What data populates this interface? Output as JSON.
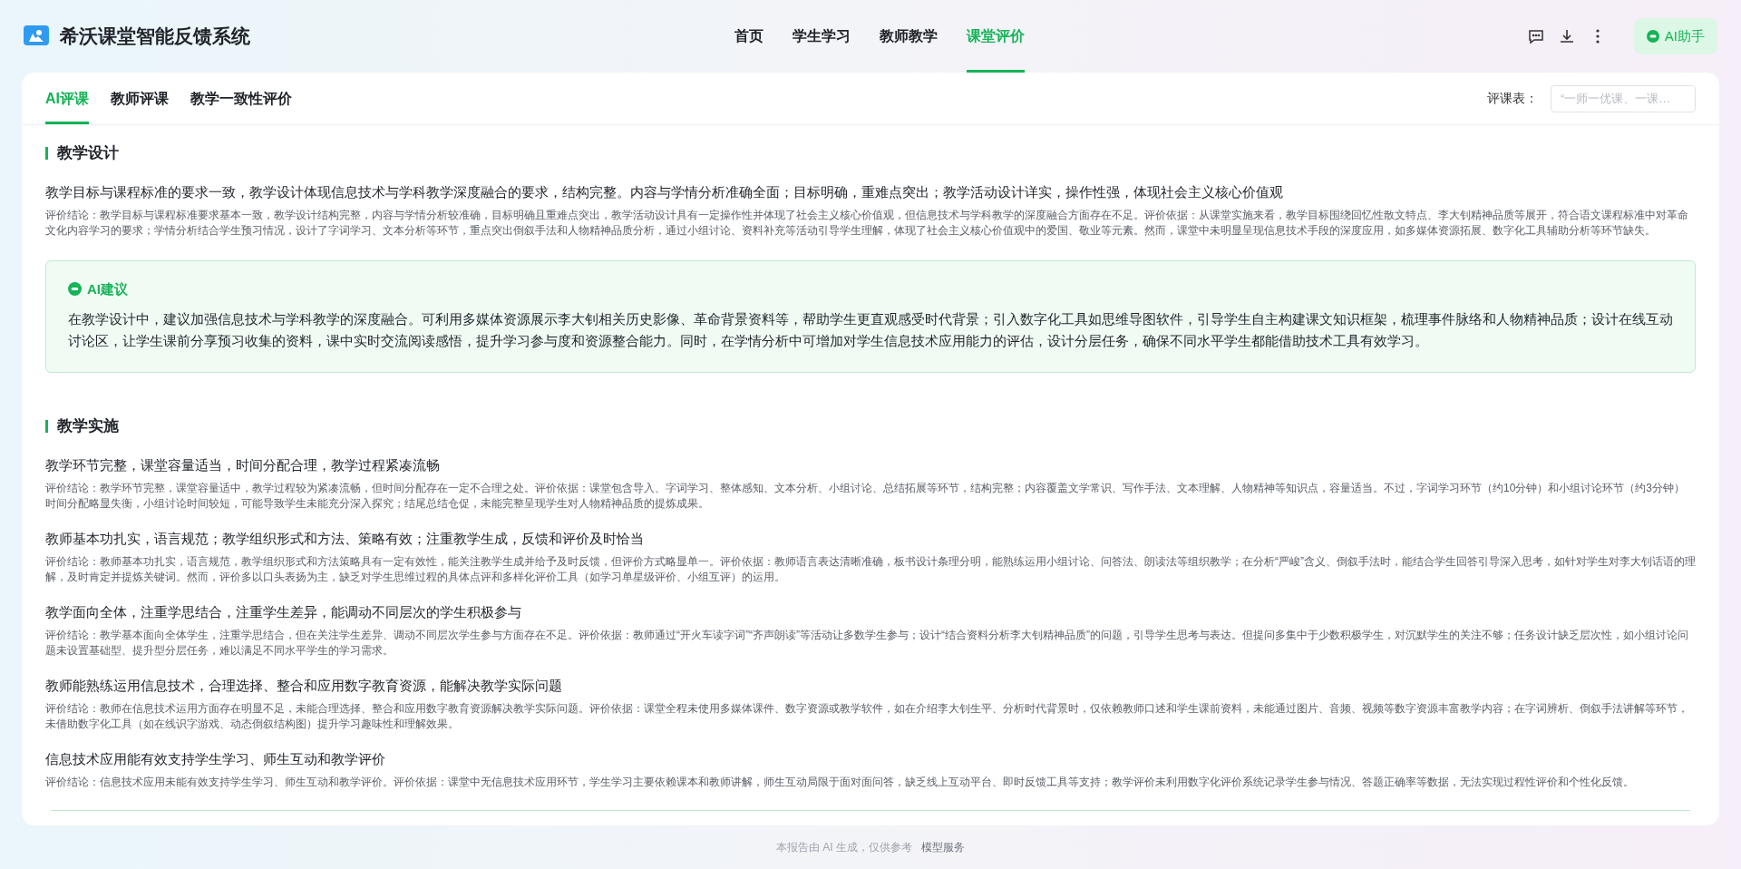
{
  "app": {
    "title": "希沃课堂智能反馈系统"
  },
  "nav": [
    {
      "label": "首页",
      "selected": false
    },
    {
      "label": "学生学习",
      "selected": false
    },
    {
      "label": "教师教学",
      "selected": false
    },
    {
      "label": "课堂评价",
      "selected": true
    }
  ],
  "assistant_button": {
    "label": "AI助手"
  },
  "tabs": [
    {
      "label": "AI评课",
      "selected": true
    },
    {
      "label": "教师评课",
      "selected": false
    },
    {
      "label": "教学一致性评价",
      "selected": false
    }
  ],
  "rubric": {
    "label": "评课表：",
    "placeholder": "“一师一优课、一课…"
  },
  "sections": [
    {
      "title": "教学设计",
      "items": [
        {
          "kind": "criterion",
          "title": "教学目标与课程标准的要求一致，教学设计体现信息技术与学科教学深度融合的要求，结构完整。内容与学情分析准确全面；目标明确，重难点突出；教学活动设计详实，操作性强，体现社会主义核心价值观",
          "text": "评价结论：教学目标与课程标准要求基本一致，教学设计结构完整，内容与学情分析较准确，目标明确且重难点突出，教学活动设计具有一定操作性并体现了社会主义核心价值观，但信息技术与学科教学的深度融合方面存在不足。评价依据：从课堂实施来看，教学目标围绕回忆性散文特点、李大钊精神品质等展开，符合语文课程标准中对革命文化内容学习的要求；学情分析结合学生预习情况，设计了字词学习、文本分析等环节，重点突出倒叙手法和人物精神品质分析，通过小组讨论、资料补充等活动引导学生理解，体现了社会主义核心价值观中的爱国、敬业等元素。然而，课堂中未明显呈现信息技术手段的深度应用，如多媒体资源拓展、数字化工具辅助分析等环节缺失。"
        },
        {
          "kind": "suggestion",
          "title": "AI建议",
          "text": "在教学设计中，建议加强信息技术与学科教学的深度融合。可利用多媒体资源展示李大钊相关历史影像、革命背景资料等，帮助学生更直观感受时代背景；引入数字化工具如思维导图软件，引导学生自主构建课文知识框架，梳理事件脉络和人物精神品质；设计在线互动讨论区，让学生课前分享预习收集的资料，课中实时交流阅读感悟，提升学习参与度和资源整合能力。同时，在学情分析中可增加对学生信息技术应用能力的评估，设计分层任务，确保不同水平学生都能借助技术工具有效学习。"
        }
      ]
    },
    {
      "title": "教学实施",
      "items": [
        {
          "kind": "criterion",
          "title": "教学环节完整，课堂容量适当，时间分配合理，教学过程紧凑流畅",
          "text": "评价结论：教学环节完整，课堂容量适中，教学过程较为紧凑流畅，但时间分配存在一定不合理之处。评价依据：课堂包含导入、字词学习、整体感知、文本分析、小组讨论、总结拓展等环节，结构完整；内容覆盖文学常识、写作手法、文本理解、人物精神等知识点，容量适当。不过，字词学习环节（约10分钟）和小组讨论环节（约3分钟）时间分配略显失衡，小组讨论时间较短，可能导致学生未能充分深入探究；结尾总结仓促，未能完整呈现学生对人物精神品质的提炼成果。"
        },
        {
          "kind": "criterion",
          "title": "教师基本功扎实，语言规范；教学组织形式和方法、策略有效；注重教学生成，反馈和评价及时恰当",
          "text": "评价结论：教师基本功扎实，语言规范，教学组织形式和方法策略具有一定有效性，能关注教学生成并给予及时反馈，但评价方式略显单一。评价依据：教师语言表达清晰准确，板书设计条理分明，能熟练运用小组讨论、问答法、朗读法等组织教学；在分析“严峻”含义、倒叙手法时，能结合学生回答引导深入思考，如针对学生对李大钊话语的理解，及时肯定并提炼关键词。然而，评价多以口头表扬为主，缺乏对学生思维过程的具体点评和多样化评价工具（如学习单星级评价、小组互评）的运用。"
        },
        {
          "kind": "criterion",
          "title": "教学面向全体，注重学思结合，注重学生差异，能调动不同层次的学生积极参与",
          "text": "评价结论：教学基本面向全体学生，注重学思结合，但在关注学生差异、调动不同层次学生参与方面存在不足。评价依据：教师通过“开火车读字词”“齐声朗读”等活动让多数学生参与；设计“结合资料分析李大钊精神品质”的问题，引导学生思考与表达。但提问多集中于少数积极学生，对沉默学生的关注不够；任务设计缺乏层次性，如小组讨论问题未设置基础型、提升型分层任务，难以满足不同水平学生的学习需求。"
        },
        {
          "kind": "criterion",
          "title": "教师能熟练运用信息技术，合理选择、整合和应用数字教育资源，能解决教学实际问题",
          "text": "评价结论：教师在信息技术运用方面存在明显不足，未能合理选择、整合和应用数字教育资源解决教学实际问题。评价依据：课堂全程未使用多媒体课件、数字资源或教学软件，如在介绍李大钊生平、分析时代背景时，仅依赖教师口述和学生课前资料，未能通过图片、音频、视频等数字资源丰富教学内容；在字词辨析、倒叙手法讲解等环节，未借助数字化工具（如在线识字游戏、动态倒叙结构图）提升学习趣味性和理解效果。"
        },
        {
          "kind": "criterion",
          "title": "信息技术应用能有效支持学生学习、师生互动和教学评价",
          "text": "评价结论：信息技术应用未能有效支持学生学习、师生互动和教学评价。评价依据：课堂中无信息技术应用环节，学生学习主要依赖课本和教师讲解，师生互动局限于面对面问答，缺乏线上互动平台、即时反馈工具等支持；教学评价未利用数字化评价系统记录学生参与情况、答题正确率等数据，无法实现过程性评价和个性化反馈。"
        }
      ]
    }
  ],
  "footer": {
    "note": "本报告由 AI 生成，仅供参考",
    "link": "模型服务"
  }
}
